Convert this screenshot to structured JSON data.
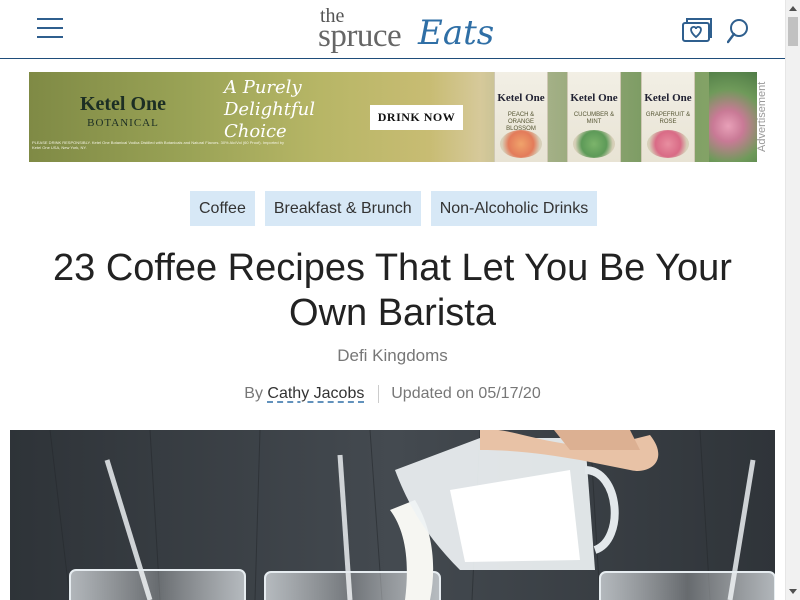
{
  "header": {
    "logo": {
      "the": "the",
      "spruce": "spruce",
      "eats": "Eats"
    },
    "icons": {
      "menu": "hamburger-menu-icon",
      "recipe_box": "recipe-box-heart-icon",
      "search": "search-icon"
    },
    "accent_color": "#2f6fa6"
  },
  "ad": {
    "brand": "Ketel One",
    "brand_sub": "BOTANICAL",
    "tagline": "A Purely Delightful Choice",
    "cta": "DRINK NOW",
    "fine_print": "PLEASE DRINK RESPONSIBLY. Ketel One Botanical Vodka Distilled with Botanicals and Natural Flavors. 30% Alc/Vol (60 Proof). Imported by Ketel One USA, New York, NY.",
    "cans": [
      {
        "brand": "Ketel One",
        "flavor": "PEACH & ORANGE BLOSSOM"
      },
      {
        "brand": "Ketel One",
        "flavor": "CUCUMBER & MINT"
      },
      {
        "brand": "Ketel One",
        "flavor": "GRAPEFRUIT & ROSE"
      }
    ],
    "label": "Advertisement"
  },
  "tags": [
    "Coffee",
    "Breakfast & Brunch",
    "Non-Alcoholic Drinks"
  ],
  "article": {
    "title": "23 Coffee Recipes That Let You Be Your Own Barista",
    "subtitle": "Defi Kingdoms",
    "by_label": "By",
    "author": "Cathy Jacobs",
    "updated": "Updated on 05/17/20"
  },
  "hero": {
    "description_icon": "milk-pitcher-pouring-image"
  }
}
